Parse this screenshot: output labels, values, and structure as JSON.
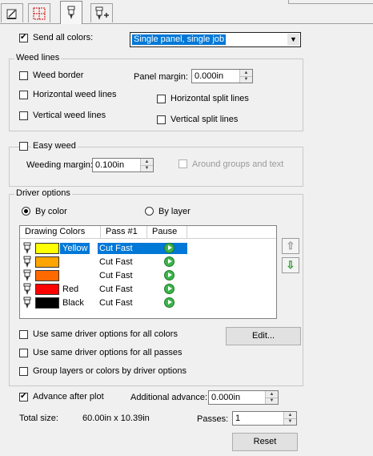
{
  "tabs": [
    {
      "icon": "document-edit-icon"
    },
    {
      "icon": "weed-border-icon"
    },
    {
      "icon": "knife-icon"
    },
    {
      "icon": "knife-add-icon"
    }
  ],
  "send_all_colors": {
    "label": "Send all colors:",
    "checked": true,
    "selected": "Single panel, single job"
  },
  "weed_lines": {
    "title": "Weed lines",
    "weed_border": "Weed border",
    "panel_margin_label": "Panel margin:",
    "panel_margin_value": "0.000in",
    "horizontal_weed": "Horizontal weed lines",
    "horizontal_split": "Horizontal split lines",
    "vertical_weed": "Vertical weed lines",
    "vertical_split": "Vertical split lines"
  },
  "easy_weed": {
    "label": "Easy weed",
    "weeding_margin_label": "Weeding margin:",
    "weeding_margin_value": "0.100in",
    "around_groups": "Around groups and text"
  },
  "driver_options": {
    "title": "Driver options",
    "by_color": "By color",
    "by_layer": "By layer",
    "columns": [
      "Drawing Colors",
      "Pass #1",
      "Pause"
    ],
    "rows": [
      {
        "name": "Yellow",
        "color": "#ffff00",
        "pass": "Cut Fast",
        "selected": true
      },
      {
        "name": "",
        "color": "#ffa500",
        "pass": "Cut Fast",
        "selected": false
      },
      {
        "name": "",
        "color": "#ff6a00",
        "pass": "Cut Fast",
        "selected": false
      },
      {
        "name": "Red",
        "color": "#ff0000",
        "pass": "Cut Fast",
        "selected": false
      },
      {
        "name": "Black",
        "color": "#000000",
        "pass": "Cut Fast",
        "selected": false
      }
    ],
    "same_all_colors": "Use same driver options for all colors",
    "same_all_passes": "Use same driver options for all passes",
    "group_layers": "Group layers or colors by driver options",
    "edit_button": "Edit..."
  },
  "advance": {
    "label": "Advance after plot",
    "checked": true,
    "additional_label": "Additional advance:",
    "additional_value": "0.000in"
  },
  "total_size": {
    "label": "Total size:",
    "value": "60.00in x 10.39in"
  },
  "passes": {
    "label": "Passes:",
    "value": "1"
  },
  "reset_button": "Reset"
}
